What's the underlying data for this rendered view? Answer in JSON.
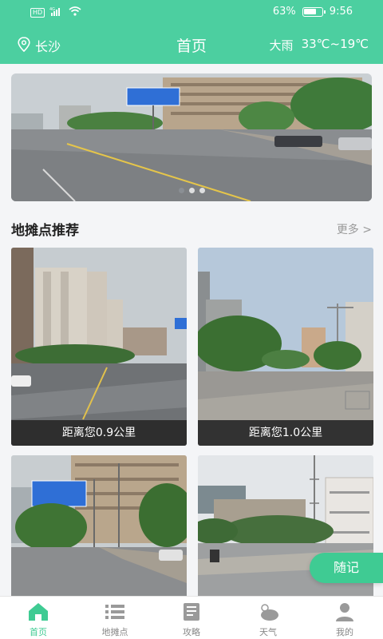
{
  "status_bar": {
    "network": "HD",
    "signal": "4G",
    "battery_pct": "63%",
    "time": "9:56"
  },
  "header": {
    "city": "长沙",
    "title": "首页",
    "weather_cond": "大雨",
    "temp_range": "33℃~19℃"
  },
  "banner": {
    "slides": 3,
    "active_index": 0
  },
  "section": {
    "title": "地摊点推荐",
    "more": "更多 >"
  },
  "cards": [
    {
      "distance": "距离您0.9公里"
    },
    {
      "distance": "距离您1.0公里"
    },
    {
      "distance": ""
    },
    {
      "distance": ""
    }
  ],
  "fab": {
    "label": "随记"
  },
  "nav": [
    {
      "label": "首页",
      "icon": "home-icon",
      "active": true
    },
    {
      "label": "地摊点",
      "icon": "list-icon",
      "active": false
    },
    {
      "label": "攻略",
      "icon": "guide-book-icon",
      "active": false
    },
    {
      "label": "天气",
      "icon": "weather-cloud-icon",
      "active": false
    },
    {
      "label": "我的",
      "icon": "profile-icon",
      "active": false
    }
  ],
  "colors": {
    "brand": "#4ccfa0",
    "accent": "#3fcb93",
    "caption_bg": "#282828"
  }
}
